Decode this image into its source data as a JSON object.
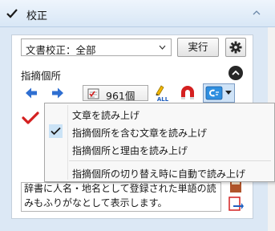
{
  "header": {
    "title": "校正",
    "check_icon": "checkmark-icon",
    "collapse_icon": "chevron-up-icon"
  },
  "toolbar": {
    "proofread_mode": {
      "selected": "文書校正：全部"
    },
    "run_label": "実行",
    "settings_icon": "gear-icon"
  },
  "issues": {
    "section_label": "指摘個所",
    "count": "961個",
    "buttons": [
      {
        "name": "prev-issue-button",
        "icon": "arrow-left-icon"
      },
      {
        "name": "next-issue-button",
        "icon": "arrow-right-icon"
      },
      {
        "name": "read-all-button",
        "icon": "read-all-icon"
      },
      {
        "name": "magnet-button",
        "icon": "magnet-icon"
      },
      {
        "name": "read-aloud-button",
        "icon": "speech-bubble-icon"
      }
    ]
  },
  "read_menu": {
    "items": [
      {
        "label": "文章を読み上げ",
        "checked": false
      },
      {
        "label": "指摘個所を含む文章を読み上げ",
        "checked": true
      },
      {
        "label": "指摘個所と理由を読み上げ",
        "checked": false
      },
      {
        "label": "指摘個所の切り替え時に自動で読み上げ",
        "checked": false
      }
    ]
  },
  "description": {
    "text": "辞書に人名・地名として登録された単語の読みもふりがなとして表示します。"
  },
  "colors": {
    "accent": "#1f5fbf",
    "panel_bg": "#dce8f5",
    "checkmark": "#d42020"
  }
}
